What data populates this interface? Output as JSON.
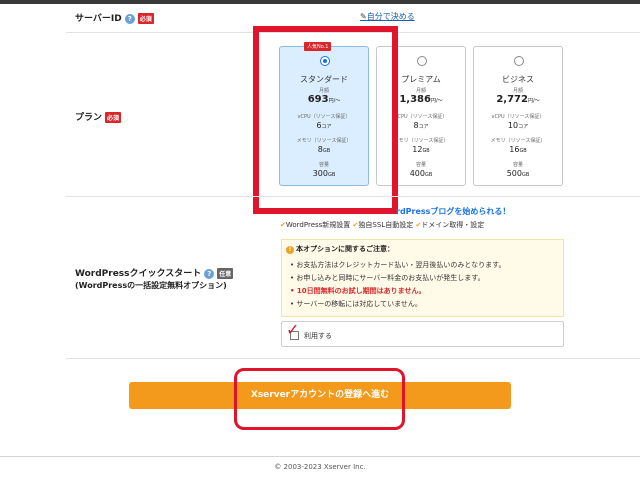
{
  "server_id": {
    "label": "サーバーID",
    "required_badge": "必須",
    "help_icon": "question-icon",
    "edit_link": "自分で決める",
    "edit_icon": "pencil-icon"
  },
  "plan": {
    "label": "プラン",
    "required_badge": "必須",
    "popular_badge": "人気No.1",
    "selected": "スタンダード",
    "spec_labels": {
      "monthly": "月額",
      "vcpu": "vCPU（リソース保証）",
      "memory": "メモリ（リソース保証）",
      "storage": "容量"
    },
    "units": {
      "price": "円/～",
      "vcpu": "コア",
      "size": "GB"
    },
    "options": [
      {
        "name": "スタンダード",
        "price": "693",
        "vcpu": "6",
        "memory": "8",
        "storage": "300"
      },
      {
        "name": "プレミアム",
        "price": "1,386",
        "vcpu": "8",
        "memory": "12",
        "storage": "400"
      },
      {
        "name": "ビジネス",
        "price": "2,772",
        "vcpu": "10",
        "memory": "16",
        "storage": "500"
      }
    ]
  },
  "wp_quick_start": {
    "label": "WordPressクイックスタート",
    "sublabel": "(WordPressの一括設定無料オプション)",
    "optional_badge": "任意",
    "promo": "rdPressブログを始められる！",
    "features": [
      "WordPress新規設置",
      "独自SSL自動設定",
      "ドメイン取得・設定"
    ],
    "notice_title": "本オプションに関するご注意：",
    "notice_items": [
      "お支払方法はクレジットカード払い・翌月後払いのみとなります。",
      "お申し込みと同時にサーバー料金のお支払いが発生します。",
      "10日間無料のお試し期間はありません。",
      "サーバーの移転には対応していません。"
    ],
    "checkbox_label": "利用する"
  },
  "submit_button": "Xserverアカウントの登録へ進む",
  "footer": {
    "copyright": "© 2003-2023 Xserver Inc."
  },
  "colors": {
    "accent_orange": "#f39a1c",
    "required_red": "#d9262a",
    "link_blue": "#1a5fb4",
    "selected_bg": "#dbeeff",
    "annotation_red": "#e0142a"
  }
}
